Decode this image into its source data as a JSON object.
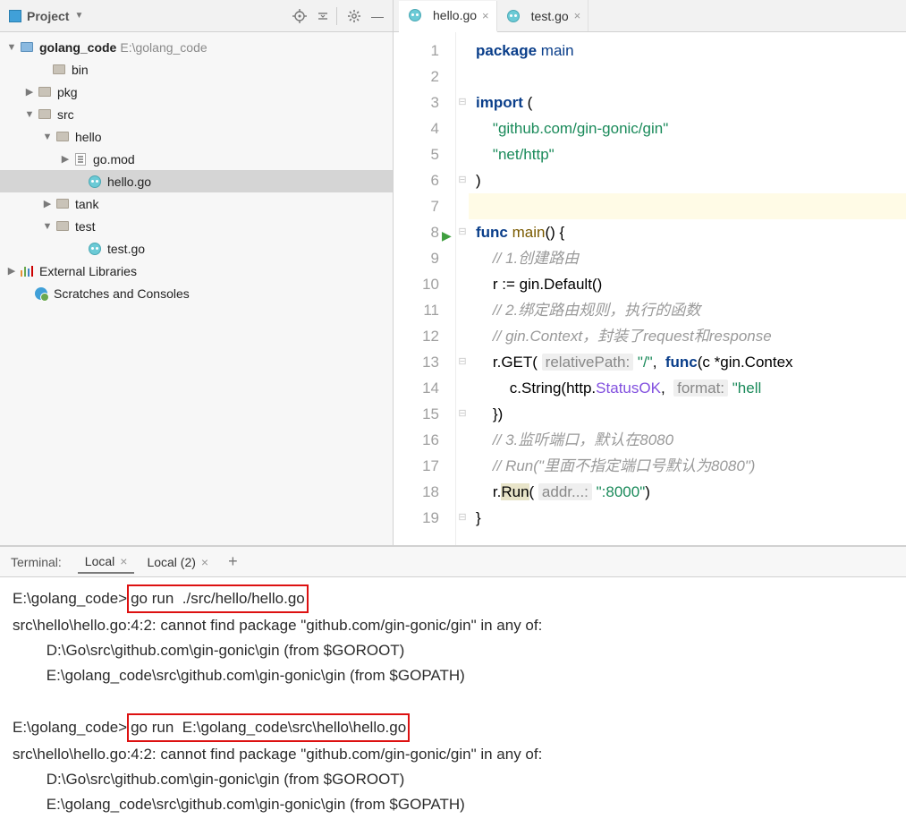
{
  "sidebar": {
    "title": "Project",
    "root": {
      "name": "golang_code",
      "path": "E:\\golang_code"
    },
    "nodes": {
      "bin": "bin",
      "pkg": "pkg",
      "src": "src",
      "hello": "hello",
      "gomod": "go.mod",
      "hellogo": "hello.go",
      "tank": "tank",
      "test": "test",
      "testgo": "test.go",
      "extlib": "External Libraries",
      "scratch": "Scratches and Consoles"
    }
  },
  "tabs": [
    {
      "label": "hello.go",
      "active": true
    },
    {
      "label": "test.go",
      "active": false
    }
  ],
  "code": {
    "lines": [
      {
        "n": 1,
        "html": "<span class='kw'>package</span> <span class='pkg'>main</span>"
      },
      {
        "n": 2,
        "html": ""
      },
      {
        "n": 3,
        "html": "<span class='kw'>import</span> ("
      },
      {
        "n": 4,
        "html": "    <span class='str'>\"github.com/gin-gonic/gin\"</span>"
      },
      {
        "n": 5,
        "html": "    <span class='str'>\"net/http\"</span>"
      },
      {
        "n": 6,
        "html": ")"
      },
      {
        "n": 7,
        "html": "",
        "hl": true
      },
      {
        "n": 8,
        "html": "<span class='kw'>func</span> <span class='fn'>main</span>() {"
      },
      {
        "n": 9,
        "html": "    <span class='cm'>// 1.创建路由</span>"
      },
      {
        "n": 10,
        "html": "    r := gin.Default()"
      },
      {
        "n": 11,
        "html": "    <span class='cm'>// 2.绑定路由规则，执行的函数</span>"
      },
      {
        "n": 12,
        "html": "    <span class='cm'>// gin.Context，封装了request和response</span>"
      },
      {
        "n": 13,
        "html": "    r.GET( <span class='hint'>relativePath:</span> <span class='str'>\"/\"</span>,  <span class='kw'>func</span>(c *gin.Contex"
      },
      {
        "n": 14,
        "html": "        c.String(http.<span style='color:#8250df'>StatusOK</span>,  <span class='hint'>format:</span> <span class='str'>\"hell</span>"
      },
      {
        "n": 15,
        "html": "    })"
      },
      {
        "n": 16,
        "html": "    <span class='cm'>// 3.监听端口，默认在8080</span>"
      },
      {
        "n": 17,
        "html": "    <span class='cm'>// Run(\"里面不指定端口号默认为8080\")</span>"
      },
      {
        "n": 18,
        "html": "    r.<span class='fnwarn'>Run</span>( <span class='hint'>addr...:</span> <span class='str'>\":8000\"</span>)"
      },
      {
        "n": 19,
        "html": "}"
      }
    ],
    "fold": {
      "3": "⊟",
      "6": "⊟",
      "8": "⊟",
      "13": "⊟",
      "15": "⊟",
      "19": "⊟"
    }
  },
  "terminal": {
    "label": "Terminal:",
    "tabs": [
      {
        "label": "Local",
        "active": true
      },
      {
        "label": "Local (2)",
        "active": false
      }
    ],
    "lines": [
      {
        "prompt": "E:\\golang_code>",
        "cmd": "go run  ./src/hello/hello.go",
        "boxed": true
      },
      {
        "text": "src\\hello\\hello.go:4:2: cannot find package \"github.com/gin-gonic/gin\" in any of:"
      },
      {
        "text": "        D:\\Go\\src\\github.com\\gin-gonic\\gin (from $GOROOT)"
      },
      {
        "text": "        E:\\golang_code\\src\\github.com\\gin-gonic\\gin (from $GOPATH)"
      },
      {
        "text": ""
      },
      {
        "prompt": "E:\\golang_code>",
        "cmd": "go run  E:\\golang_code\\src\\hello\\hello.go",
        "boxed": true
      },
      {
        "text": "src\\hello\\hello.go:4:2: cannot find package \"github.com/gin-gonic/gin\" in any of:"
      },
      {
        "text": "        D:\\Go\\src\\github.com\\gin-gonic\\gin (from $GOROOT)"
      },
      {
        "text": "        E:\\golang_code\\src\\github.com\\gin-gonic\\gin (from $GOPATH)"
      }
    ]
  }
}
